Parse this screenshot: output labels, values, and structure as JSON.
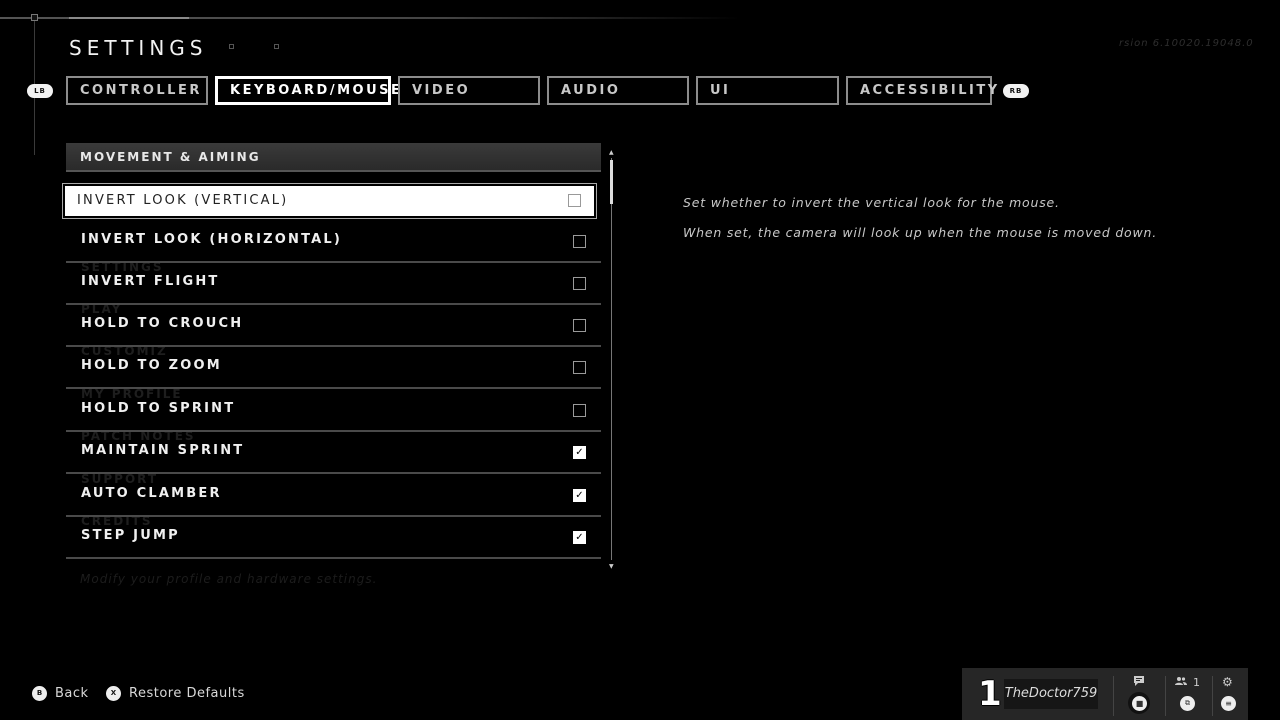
{
  "header": {
    "title": "SETTINGS",
    "version": "rsion 6.10020.19048.0"
  },
  "bumpers": {
    "left": "LB",
    "right": "RB"
  },
  "tabs": [
    {
      "label": "CONTROLLER",
      "active": false
    },
    {
      "label": "KEYBOARD/MOUSE",
      "active": true
    },
    {
      "label": "VIDEO",
      "active": false
    },
    {
      "label": "AUDIO",
      "active": false
    },
    {
      "label": "UI",
      "active": false
    },
    {
      "label": "ACCESSIBILITY",
      "active": false
    }
  ],
  "section": {
    "title": "MOVEMENT & AIMING"
  },
  "settings": [
    {
      "label": "INVERT LOOK (VERTICAL)",
      "checked": false,
      "selected": true
    },
    {
      "label": "INVERT LOOK (HORIZONTAL)",
      "checked": false
    },
    {
      "label": "INVERT FLIGHT",
      "checked": false
    },
    {
      "label": "HOLD TO CROUCH",
      "checked": false
    },
    {
      "label": "HOLD TO ZOOM",
      "checked": false
    },
    {
      "label": "HOLD TO SPRINT",
      "checked": false
    },
    {
      "label": "MAINTAIN SPRINT",
      "checked": true
    },
    {
      "label": "AUTO CLAMBER",
      "checked": true
    },
    {
      "label": "STEP JUMP",
      "checked": true
    }
  ],
  "checkmark_glyph": "✓",
  "background_menu": {
    "items": [
      "SETTINGS",
      "PLAY",
      "CUSTOMIZ",
      "MY PROFILE",
      "PATCH NOTES",
      "SUPPORT",
      "CREDITS"
    ],
    "hint": "Modify your profile and hardware settings."
  },
  "description": {
    "line1": "Set whether to invert the vertical look for the mouse.",
    "line2": "When set, the camera will look up when the mouse is moved down."
  },
  "scroll": {
    "up_glyph": "▲",
    "down_glyph": "▼"
  },
  "footer": {
    "back": {
      "glyph": "B",
      "label": "Back"
    },
    "restore": {
      "glyph": "X",
      "label": "Restore Defaults"
    }
  },
  "player": {
    "rank": "1",
    "gamertag": "TheDoctor759",
    "friends_count": "1",
    "chat_icon": "chat-icon",
    "friends_icon": "friends-icon",
    "settings_icon": "gear-icon"
  }
}
